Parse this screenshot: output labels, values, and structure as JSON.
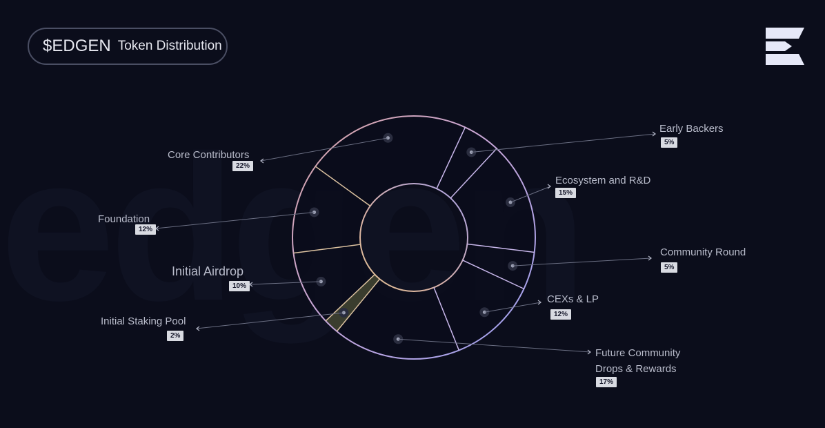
{
  "header": {
    "token": "$EDGEN",
    "subtitle": "Token Distribution"
  },
  "logo_icon": "edgen-logo-icon",
  "colors": {
    "background": "#0b0d1b",
    "badge": "#d9dbe2",
    "ring_warm": "#d8a8a0",
    "ring_cool": "#a9a3e8"
  },
  "chart_data": {
    "type": "pie",
    "title": "Token Distribution",
    "segments": [
      {
        "label": "Early Backers",
        "value": 5,
        "value_label": "5%"
      },
      {
        "label": "Ecosystem and R&D",
        "value": 15,
        "value_label": "15%"
      },
      {
        "label": "Community Round",
        "value": 5,
        "value_label": "5%"
      },
      {
        "label": "CEXs & LP",
        "value": 12,
        "value_label": "12%"
      },
      {
        "label": "Future Community Drops & Rewards",
        "label_lines": [
          "Future Community",
          "Drops & Rewards"
        ],
        "value": 17,
        "value_label": "17%"
      },
      {
        "label": "Initial Staking Pool",
        "value": 2,
        "value_label": "2%"
      },
      {
        "label": "Initial Airdrop",
        "value": 10,
        "value_label": "10%"
      },
      {
        "label": "Foundation",
        "value": 12,
        "value_label": "12%"
      },
      {
        "label": "Core Contributors",
        "value": 22,
        "value_label": "22%"
      }
    ]
  }
}
